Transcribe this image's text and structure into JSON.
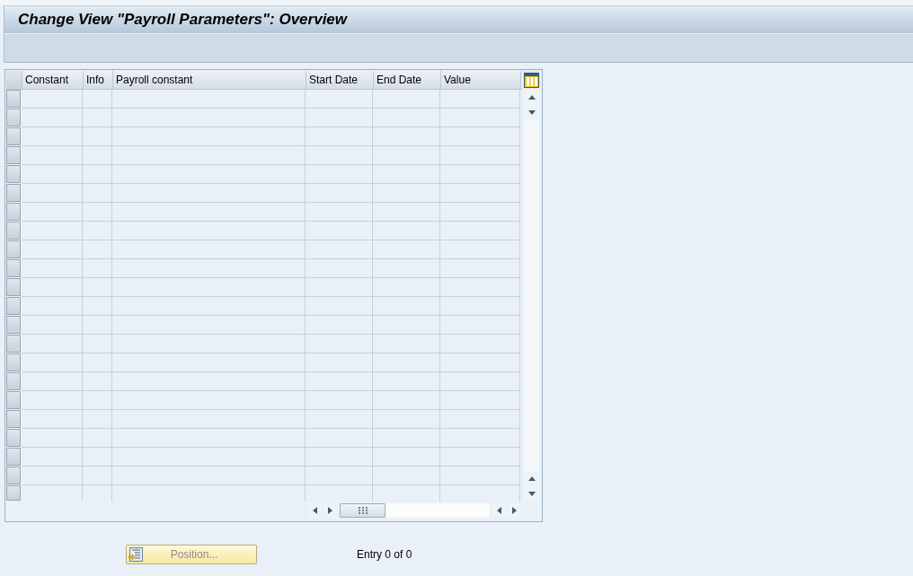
{
  "window": {
    "title": "Change View \"Payroll Parameters\": Overview"
  },
  "table": {
    "columns": [
      "Constant",
      "Info",
      "Payroll constant",
      "Start Date",
      "End Date",
      "Value"
    ]
  },
  "footer": {
    "position_button": {
      "label": "Position...",
      "disabled": true
    },
    "entry_count": "Entry 0 of 0"
  }
}
